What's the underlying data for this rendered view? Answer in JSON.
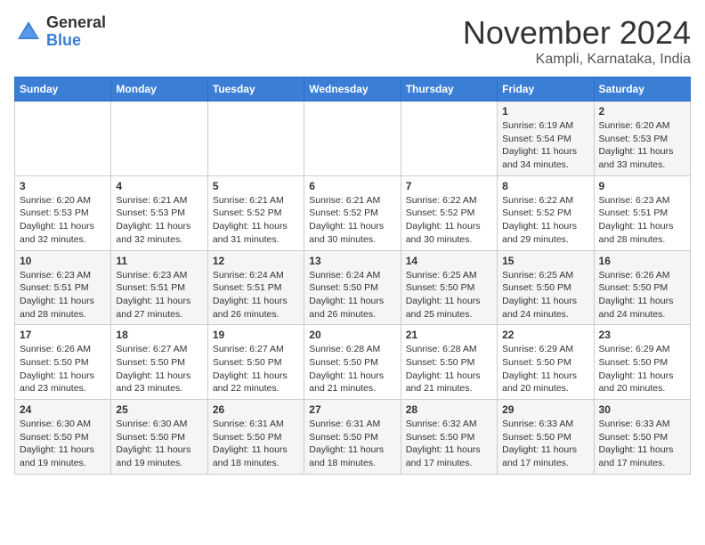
{
  "header": {
    "logo_general": "General",
    "logo_blue": "Blue",
    "month": "November 2024",
    "location": "Kampli, Karnataka, India"
  },
  "days_of_week": [
    "Sunday",
    "Monday",
    "Tuesday",
    "Wednesday",
    "Thursday",
    "Friday",
    "Saturday"
  ],
  "weeks": [
    [
      {
        "day": "",
        "info": ""
      },
      {
        "day": "",
        "info": ""
      },
      {
        "day": "",
        "info": ""
      },
      {
        "day": "",
        "info": ""
      },
      {
        "day": "",
        "info": ""
      },
      {
        "day": "1",
        "info": "Sunrise: 6:19 AM\nSunset: 5:54 PM\nDaylight: 11 hours\nand 34 minutes."
      },
      {
        "day": "2",
        "info": "Sunrise: 6:20 AM\nSunset: 5:53 PM\nDaylight: 11 hours\nand 33 minutes."
      }
    ],
    [
      {
        "day": "3",
        "info": "Sunrise: 6:20 AM\nSunset: 5:53 PM\nDaylight: 11 hours\nand 32 minutes."
      },
      {
        "day": "4",
        "info": "Sunrise: 6:21 AM\nSunset: 5:53 PM\nDaylight: 11 hours\nand 32 minutes."
      },
      {
        "day": "5",
        "info": "Sunrise: 6:21 AM\nSunset: 5:52 PM\nDaylight: 11 hours\nand 31 minutes."
      },
      {
        "day": "6",
        "info": "Sunrise: 6:21 AM\nSunset: 5:52 PM\nDaylight: 11 hours\nand 30 minutes."
      },
      {
        "day": "7",
        "info": "Sunrise: 6:22 AM\nSunset: 5:52 PM\nDaylight: 11 hours\nand 30 minutes."
      },
      {
        "day": "8",
        "info": "Sunrise: 6:22 AM\nSunset: 5:52 PM\nDaylight: 11 hours\nand 29 minutes."
      },
      {
        "day": "9",
        "info": "Sunrise: 6:23 AM\nSunset: 5:51 PM\nDaylight: 11 hours\nand 28 minutes."
      }
    ],
    [
      {
        "day": "10",
        "info": "Sunrise: 6:23 AM\nSunset: 5:51 PM\nDaylight: 11 hours\nand 28 minutes."
      },
      {
        "day": "11",
        "info": "Sunrise: 6:23 AM\nSunset: 5:51 PM\nDaylight: 11 hours\nand 27 minutes."
      },
      {
        "day": "12",
        "info": "Sunrise: 6:24 AM\nSunset: 5:51 PM\nDaylight: 11 hours\nand 26 minutes."
      },
      {
        "day": "13",
        "info": "Sunrise: 6:24 AM\nSunset: 5:50 PM\nDaylight: 11 hours\nand 26 minutes."
      },
      {
        "day": "14",
        "info": "Sunrise: 6:25 AM\nSunset: 5:50 PM\nDaylight: 11 hours\nand 25 minutes."
      },
      {
        "day": "15",
        "info": "Sunrise: 6:25 AM\nSunset: 5:50 PM\nDaylight: 11 hours\nand 24 minutes."
      },
      {
        "day": "16",
        "info": "Sunrise: 6:26 AM\nSunset: 5:50 PM\nDaylight: 11 hours\nand 24 minutes."
      }
    ],
    [
      {
        "day": "17",
        "info": "Sunrise: 6:26 AM\nSunset: 5:50 PM\nDaylight: 11 hours\nand 23 minutes."
      },
      {
        "day": "18",
        "info": "Sunrise: 6:27 AM\nSunset: 5:50 PM\nDaylight: 11 hours\nand 23 minutes."
      },
      {
        "day": "19",
        "info": "Sunrise: 6:27 AM\nSunset: 5:50 PM\nDaylight: 11 hours\nand 22 minutes."
      },
      {
        "day": "20",
        "info": "Sunrise: 6:28 AM\nSunset: 5:50 PM\nDaylight: 11 hours\nand 21 minutes."
      },
      {
        "day": "21",
        "info": "Sunrise: 6:28 AM\nSunset: 5:50 PM\nDaylight: 11 hours\nand 21 minutes."
      },
      {
        "day": "22",
        "info": "Sunrise: 6:29 AM\nSunset: 5:50 PM\nDaylight: 11 hours\nand 20 minutes."
      },
      {
        "day": "23",
        "info": "Sunrise: 6:29 AM\nSunset: 5:50 PM\nDaylight: 11 hours\nand 20 minutes."
      }
    ],
    [
      {
        "day": "24",
        "info": "Sunrise: 6:30 AM\nSunset: 5:50 PM\nDaylight: 11 hours\nand 19 minutes."
      },
      {
        "day": "25",
        "info": "Sunrise: 6:30 AM\nSunset: 5:50 PM\nDaylight: 11 hours\nand 19 minutes."
      },
      {
        "day": "26",
        "info": "Sunrise: 6:31 AM\nSunset: 5:50 PM\nDaylight: 11 hours\nand 18 minutes."
      },
      {
        "day": "27",
        "info": "Sunrise: 6:31 AM\nSunset: 5:50 PM\nDaylight: 11 hours\nand 18 minutes."
      },
      {
        "day": "28",
        "info": "Sunrise: 6:32 AM\nSunset: 5:50 PM\nDaylight: 11 hours\nand 17 minutes."
      },
      {
        "day": "29",
        "info": "Sunrise: 6:33 AM\nSunset: 5:50 PM\nDaylight: 11 hours\nand 17 minutes."
      },
      {
        "day": "30",
        "info": "Sunrise: 6:33 AM\nSunset: 5:50 PM\nDaylight: 11 hours\nand 17 minutes."
      }
    ]
  ]
}
